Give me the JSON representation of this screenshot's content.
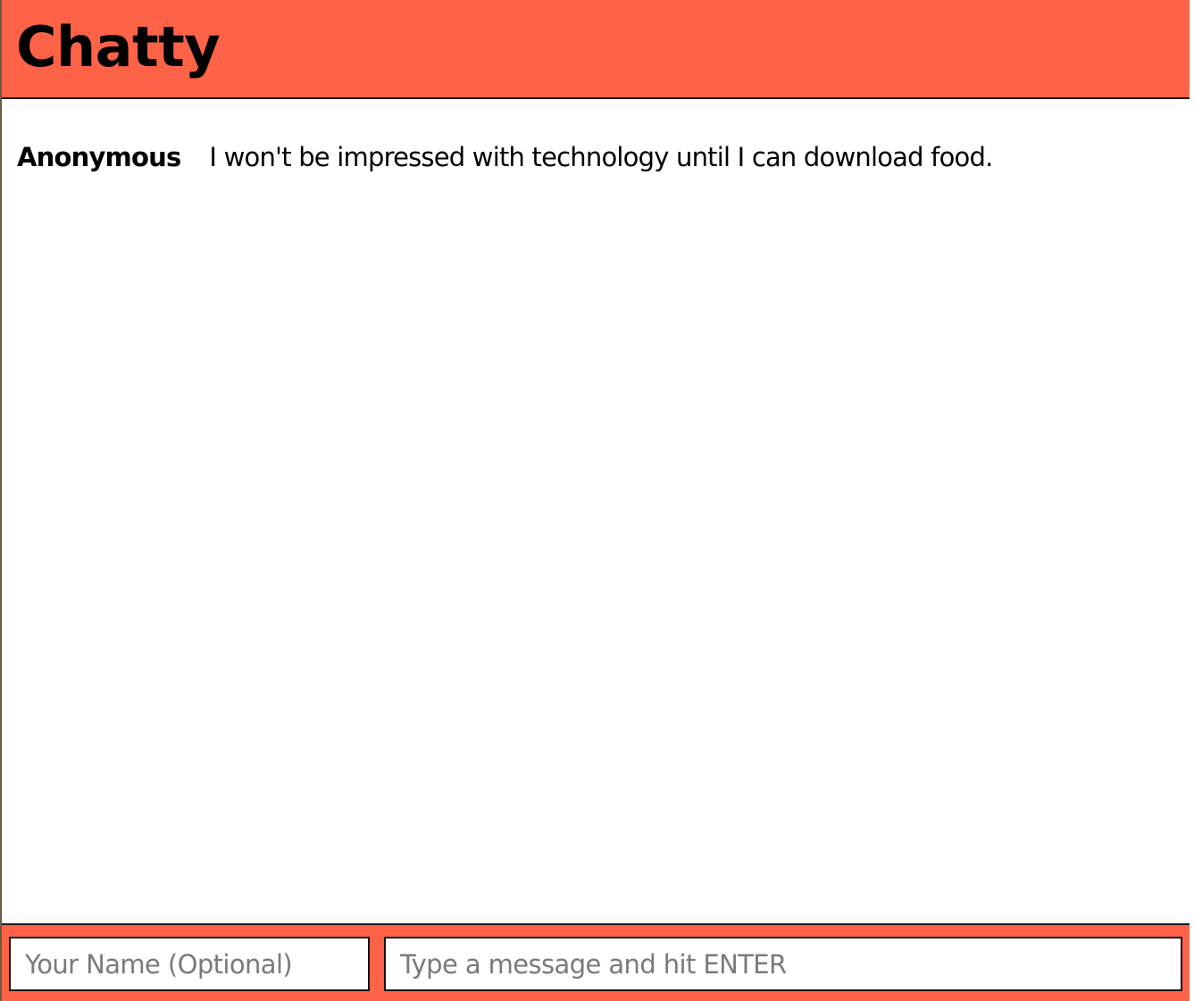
{
  "header": {
    "title": "Chatty"
  },
  "messages": [
    {
      "author": "Anonymous",
      "text": "I won't be impressed with technology until I can download food."
    }
  ],
  "composer": {
    "name_placeholder": "Your Name (Optional)",
    "message_placeholder": "Type a message and hit ENTER"
  },
  "colors": {
    "accent": "#ff6347",
    "background": "#ffffff",
    "text": "#000000"
  }
}
